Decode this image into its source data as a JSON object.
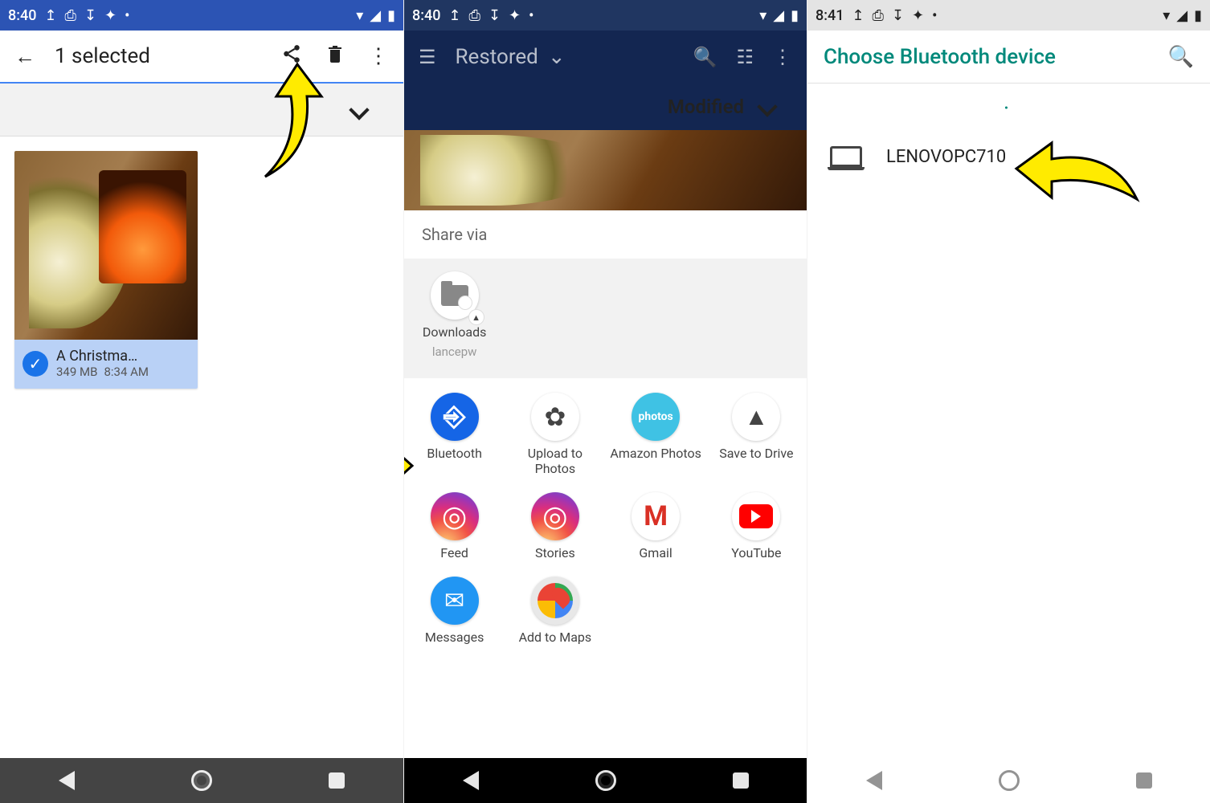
{
  "screen1": {
    "status_time": "8:40",
    "toolbar_title": "1 selected",
    "file": {
      "name": "A Christma…",
      "size": "349 MB",
      "time": "8:34 AM"
    }
  },
  "screen2": {
    "status_time": "8:40",
    "toolbar_title": "Restored",
    "sort_label": "Modified",
    "share_title": "Share via",
    "downloads": {
      "label": "Downloads",
      "user": "lancepw"
    },
    "apps": [
      {
        "label": "Bluetooth"
      },
      {
        "label": "Upload to Photos"
      },
      {
        "label": "Amazon Photos"
      },
      {
        "label": "Save to Drive"
      },
      {
        "label": "Feed"
      },
      {
        "label": "Stories"
      },
      {
        "label": "Gmail"
      },
      {
        "label": "YouTube"
      },
      {
        "label": "Messages"
      },
      {
        "label": "Add to Maps"
      }
    ]
  },
  "screen3": {
    "status_time": "8:41",
    "title": "Choose Bluetooth device",
    "device": "LENOVOPC710"
  }
}
